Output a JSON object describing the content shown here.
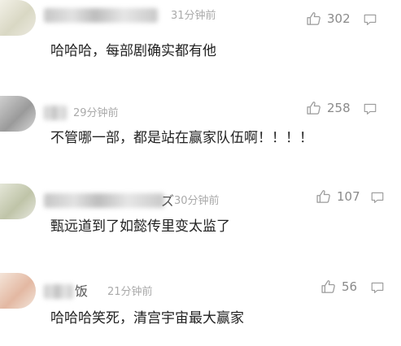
{
  "comments": [
    {
      "name_suffix": "",
      "time": "31分钟前",
      "likes": "302",
      "text": "哈哈哈，每部剧确实都有他"
    },
    {
      "name_suffix": "",
      "time": "29分钟前",
      "likes": "258",
      "text": "不管哪一部，都是站在赢家队伍啊！！！！"
    },
    {
      "name_suffix": "ズ",
      "time": "30分钟前",
      "likes": "107",
      "text": "甄远道到了如懿传里变太监了"
    },
    {
      "name_suffix": "饭",
      "time": "21分钟前",
      "likes": "56",
      "text": "哈哈哈笑死，清宫宇宙最大赢家"
    }
  ],
  "icons": {
    "like": "thumbs-up-icon",
    "reply": "comment-bubble-icon"
  },
  "colors": {
    "text": "#222222",
    "meta": "#aaaaaa",
    "icon": "#9a9a9a"
  }
}
